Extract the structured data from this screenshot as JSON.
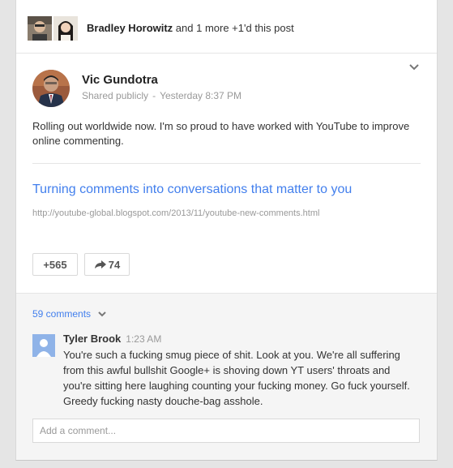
{
  "plus_bar": {
    "names": "Bradley Horowitz",
    "rest": " and 1 more +1'd this post"
  },
  "post": {
    "author": "Vic Gundotra",
    "visibility": "Shared publicly",
    "separator": "-",
    "timestamp": "Yesterday 8:37 PM",
    "text": "Rolling out worldwide now. I'm so proud to have worked with YouTube to improve online commenting.",
    "link_title": "Turning comments into conversations that matter to you",
    "link_url": "http://youtube-global.blogspot.com/2013/11/youtube-new-comments.html",
    "plus_count": "+565",
    "share_count": "74"
  },
  "comments": {
    "count_label": "59 comments",
    "items": [
      {
        "author": "Tyler Brook",
        "time": "1:23 AM",
        "text": "You're such a fucking smug piece of shit. Look at you. We're all suffering from this awful bullshit Google+ is shoving down YT users' throats and you're sitting here laughing counting your fucking money. Go fuck yourself. Greedy fucking nasty douche-bag asshole."
      }
    ],
    "add_placeholder": "Add a comment..."
  },
  "colors": {
    "link": "#427fed",
    "muted": "#999999",
    "panel": "#f5f5f5"
  }
}
